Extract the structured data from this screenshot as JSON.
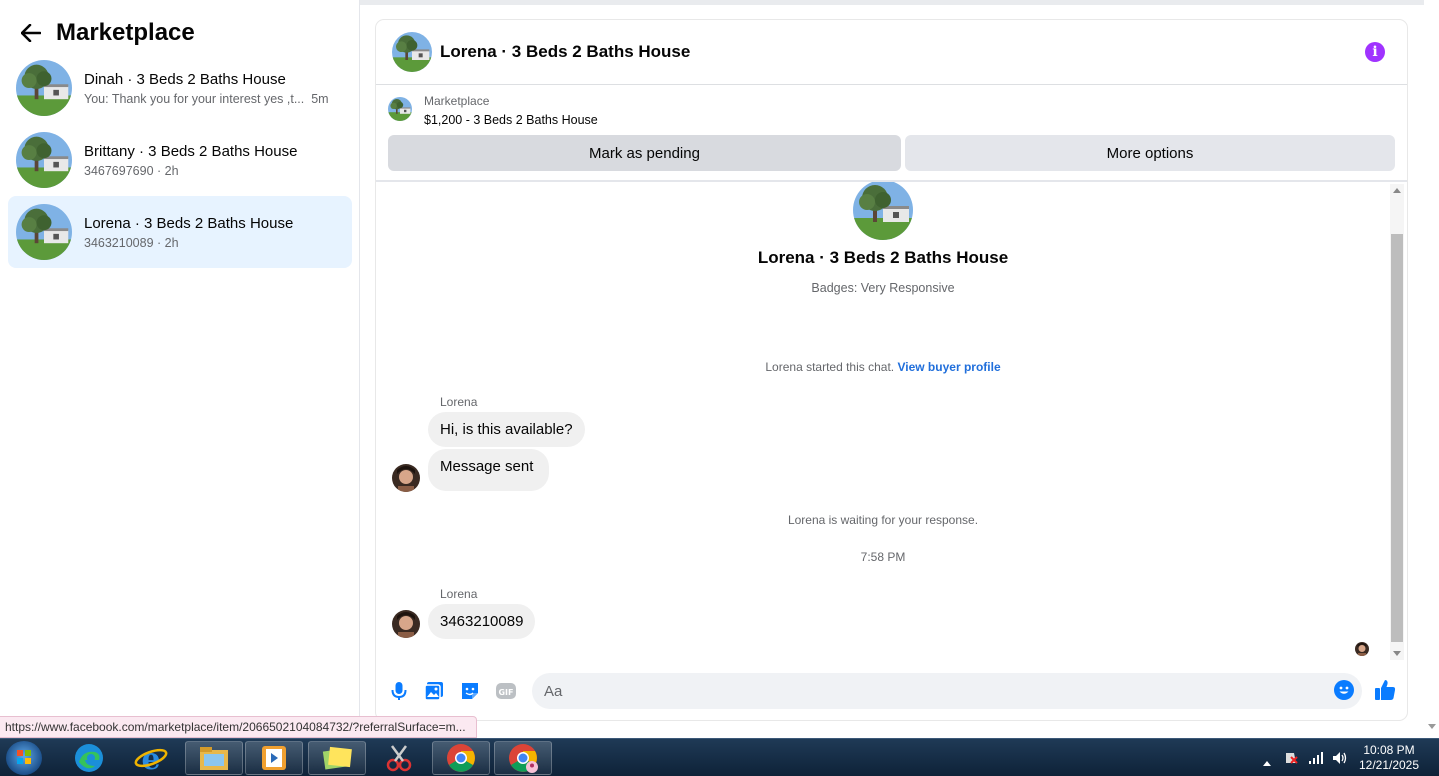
{
  "sidebar": {
    "title": "Marketplace",
    "conversations": [
      {
        "name": "Dinah · 3 Beds 2 Baths House",
        "preview": "You: Thank you for your interest yes ,t...",
        "time": "5m"
      },
      {
        "name": "Brittany · 3 Beds 2 Baths House",
        "preview": "3467697690",
        "time": "2h"
      },
      {
        "name": "Lorena · 3 Beds 2 Baths House",
        "preview": "3463210089",
        "time": "2h"
      }
    ],
    "separator": "·"
  },
  "chat": {
    "title": "Lorena · 3 Beds 2 Baths House",
    "listing_label": "Marketplace",
    "listing_price": "$1,200 - 3 Beds 2 Baths House",
    "btn_pending": "Mark as pending",
    "btn_more": "More options",
    "profile_name": "Lorena · 3 Beds 2 Baths House",
    "badges": "Badges: Very Responsive",
    "started_text": "Lorena started this chat.",
    "view_profile": "View buyer profile",
    "sender_name": "Lorena",
    "msg1": "Hi, is this available?",
    "msg2": "Message sent",
    "waiting": "Lorena is waiting for your response.",
    "timestamp": "7:58 PM",
    "msg3": "3463210089",
    "input_placeholder": "Aa"
  },
  "status_url": "https://www.facebook.com/marketplace/item/2066502104084732/?referralSurface=m...",
  "taskbar": {
    "time": "10:08 PM",
    "date": "12/21/2025"
  },
  "colors": {
    "accent": "#0a7cff",
    "info": "#a033ff",
    "link": "#216fdb",
    "active_bg": "#e7f3ff"
  }
}
